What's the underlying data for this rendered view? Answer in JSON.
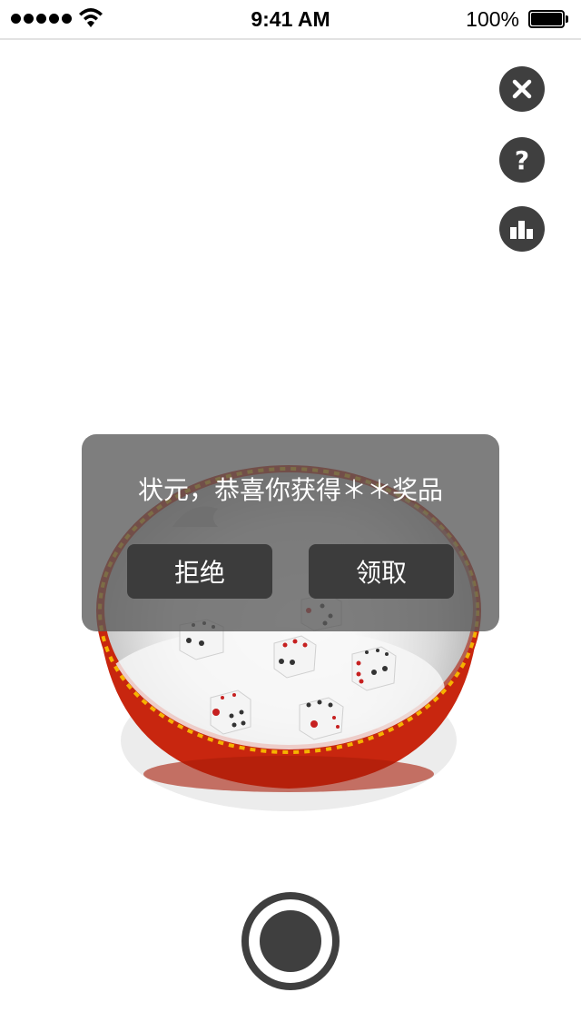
{
  "status_bar": {
    "time": "9:41 AM",
    "battery_percent": "100%",
    "signal_bars": 5,
    "battery_level": 1.0
  },
  "side_buttons": [
    {
      "name": "close",
      "icon": "close-icon"
    },
    {
      "name": "help",
      "icon": "help-icon",
      "glyph": "?"
    },
    {
      "name": "rank",
      "icon": "bar-chart-icon"
    }
  ],
  "dialog": {
    "message": "状元，恭喜你获得＊＊奖品",
    "refuse_label": "拒绝",
    "accept_label": "领取"
  },
  "shake_button": {
    "icon": "record-icon"
  },
  "colors": {
    "button_dark": "#3f3f3f",
    "bowl_red": "#c8260f",
    "bowl_gold": "#f5b300",
    "dialog_overlay": "#5a5a5a"
  },
  "dice": [
    {
      "name": "die-1"
    },
    {
      "name": "die-2"
    },
    {
      "name": "die-3"
    },
    {
      "name": "die-4"
    },
    {
      "name": "die-5"
    },
    {
      "name": "die-6"
    }
  ]
}
